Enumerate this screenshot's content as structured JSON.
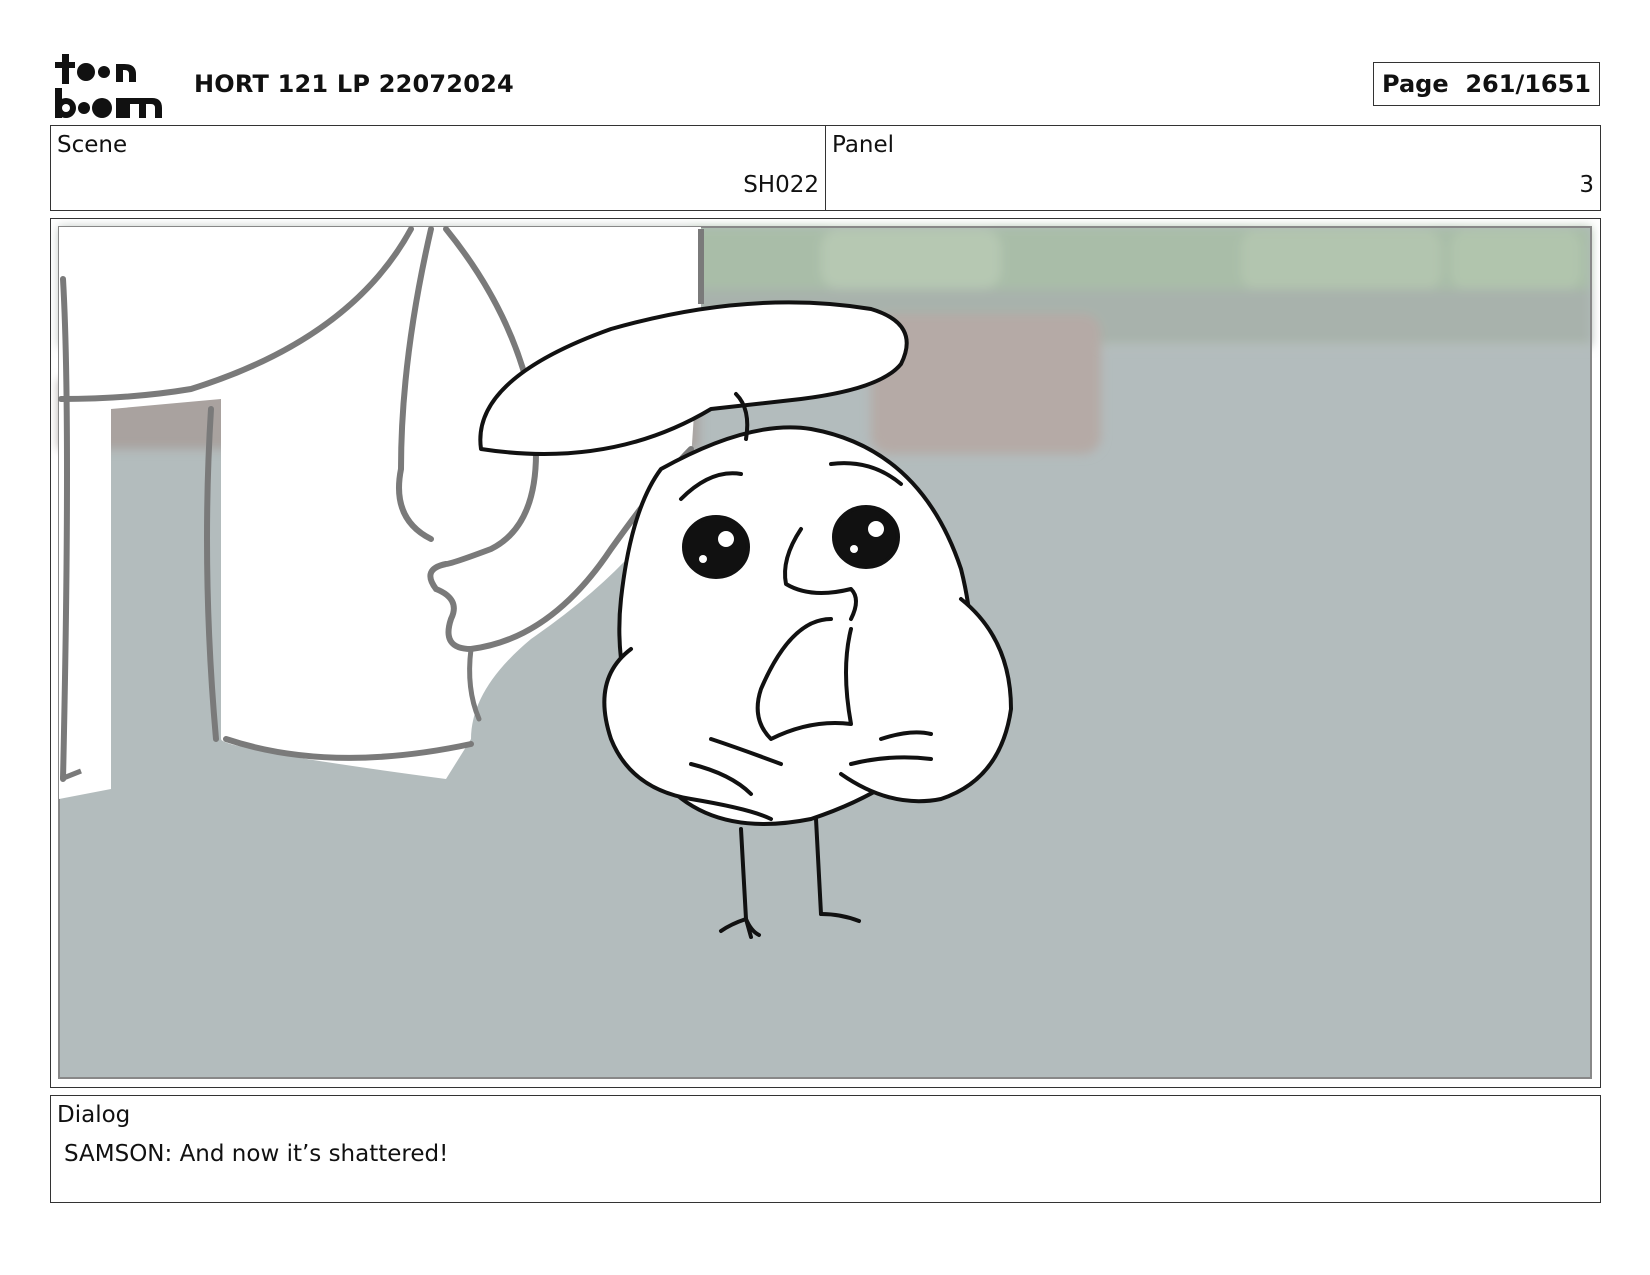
{
  "header": {
    "logo_text": "toon boom",
    "document_title": "HORT 121 LP 22072024",
    "page_label": "Page  261/1651"
  },
  "meta": {
    "scene_label": "Scene",
    "scene_value": "SH022",
    "panel_label": "Panel",
    "panel_value": "3"
  },
  "dialog": {
    "label": "Dialog",
    "text": "SAMSON: And now it’s shattered!"
  }
}
